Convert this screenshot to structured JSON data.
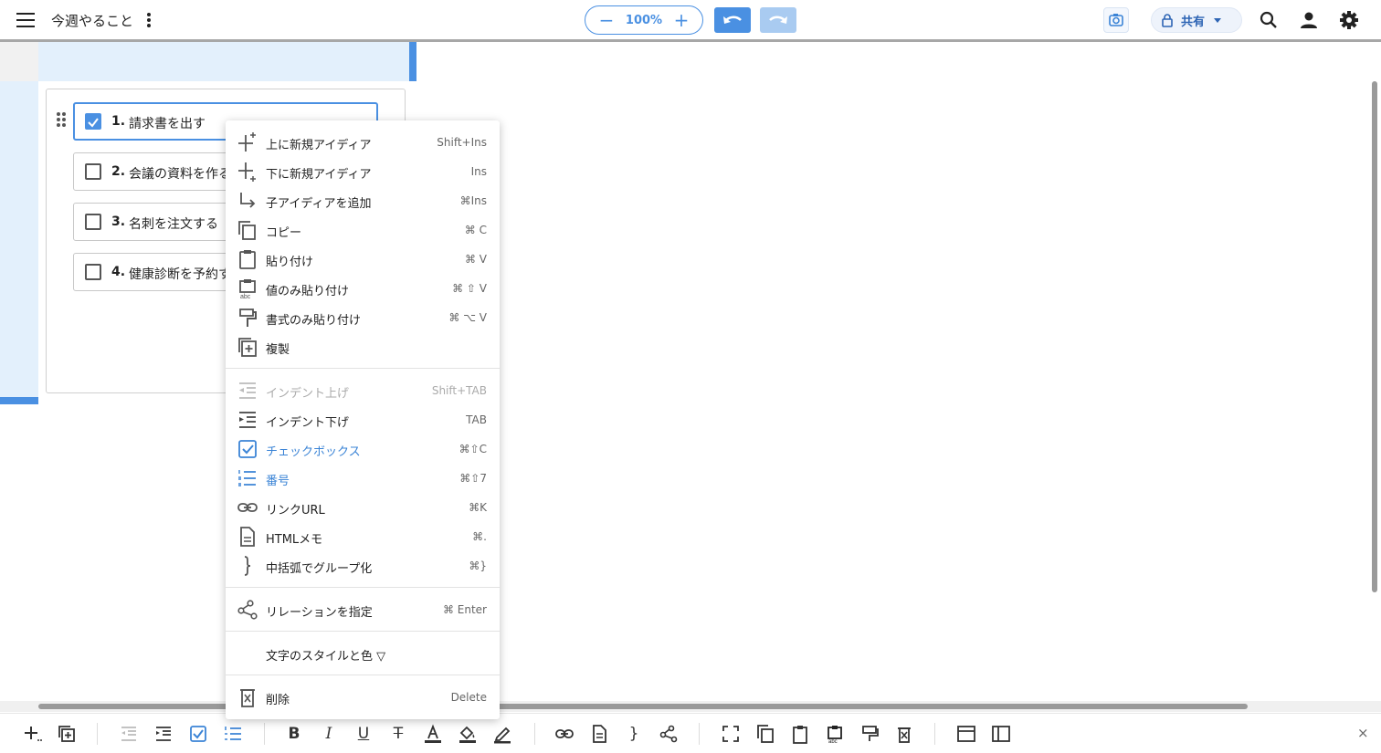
{
  "title": "今週やること",
  "zoom": {
    "value": "100%",
    "minus": "−",
    "plus": "+"
  },
  "share": {
    "label": "共有"
  },
  "items": [
    {
      "num": "1.",
      "text": "請求書を出す",
      "checked": true
    },
    {
      "num": "2.",
      "text": "会議の資料を作る",
      "checked": false
    },
    {
      "num": "3.",
      "text": "名刺を注文する",
      "checked": false
    },
    {
      "num": "4.",
      "text": "健康診断を予約する",
      "checked": false
    }
  ],
  "menu": {
    "insert_above": {
      "label": "上に新規アイディア",
      "shortcut": "Shift+Ins"
    },
    "insert_below": {
      "label": "下に新規アイディア",
      "shortcut": "Ins"
    },
    "add_child": {
      "label": "子アイディアを追加",
      "shortcut": "⌘Ins"
    },
    "copy": {
      "label": "コピー",
      "shortcut": "⌘ C"
    },
    "paste": {
      "label": "貼り付け",
      "shortcut": "⌘ V"
    },
    "paste_values": {
      "label": "値のみ貼り付け",
      "shortcut": "⌘ ⇧ V"
    },
    "paste_format": {
      "label": "書式のみ貼り付け",
      "shortcut": "⌘ ⌥ V"
    },
    "duplicate": {
      "label": "複製",
      "shortcut": ""
    },
    "outdent": {
      "label": "インデント上げ",
      "shortcut": "Shift+TAB"
    },
    "indent": {
      "label": "インデント下げ",
      "shortcut": "TAB"
    },
    "checkbox": {
      "label": "チェックボックス",
      "shortcut": "⌘⇧C"
    },
    "numbering": {
      "label": "番号",
      "shortcut": "⌘⇧7"
    },
    "link": {
      "label": "リンクURL",
      "shortcut": "⌘K"
    },
    "html_memo": {
      "label": "HTMLメモ",
      "shortcut": "⌘."
    },
    "group": {
      "label": "中括弧でグループ化",
      "shortcut": "⌘}"
    },
    "relation": {
      "label": "リレーションを指定",
      "shortcut": "⌘ Enter"
    },
    "text_style": {
      "label": "文字のスタイルと色 ▽",
      "shortcut": ""
    },
    "delete": {
      "label": "削除",
      "shortcut": "Delete"
    }
  },
  "bottom": {
    "close": "×"
  },
  "colors": {
    "accent": "#4a90e2",
    "light_accent": "#e3f0fc"
  }
}
